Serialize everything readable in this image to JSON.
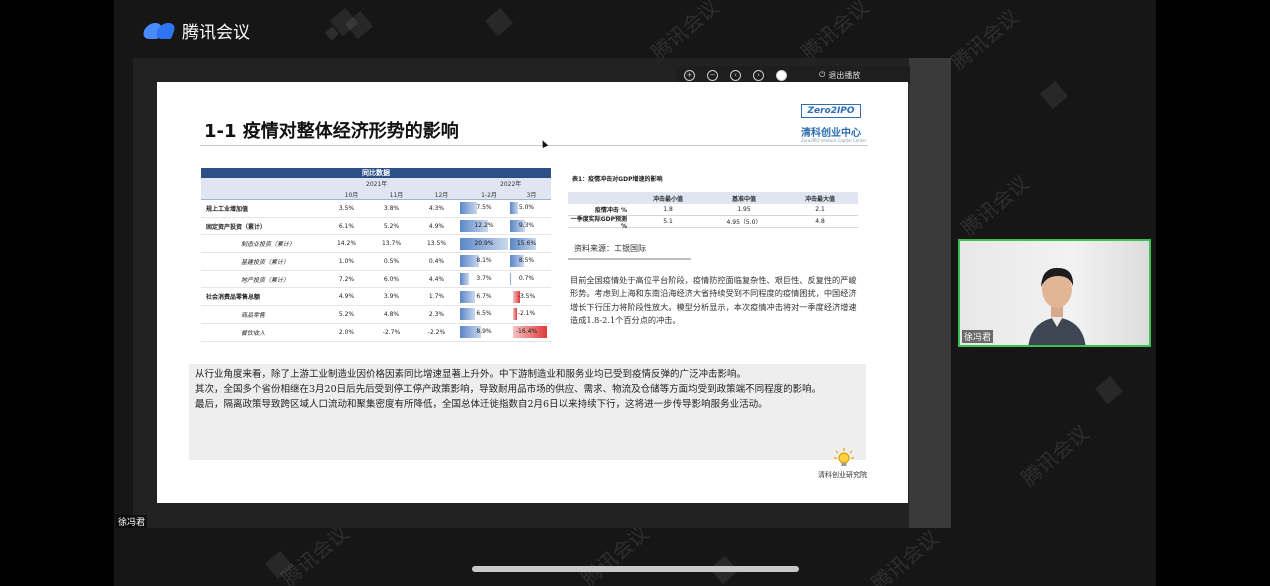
{
  "app": {
    "name": "腾讯会议",
    "watermark": "腾讯会议"
  },
  "toolbar": {
    "exit_label": "退出播放"
  },
  "slide": {
    "title": "1-1 疫情对整体经济形势的影响",
    "logo_text": "Zero2IPO",
    "logo_cn": "清科创业中心",
    "logo_en": "Zero2IPO Venture Capital Center",
    "table1": {
      "header": "同比数据",
      "group_2021": "2021年",
      "group_2022": "2022年",
      "columns": [
        "10月",
        "11月",
        "12月",
        "1-2月",
        "3月"
      ],
      "rows": [
        {
          "label": "规上工业增加值",
          "v": [
            "3.5%",
            "3.8%",
            "4.3%",
            "7.5%",
            "5.0%"
          ],
          "bar1": 0.36,
          "bar2": 0.24,
          "style": "bold"
        },
        {
          "label": "固定资产投资（累计）",
          "v": [
            "6.1%",
            "5.2%",
            "4.9%",
            "12.2%",
            "9.3%"
          ],
          "bar1": 0.58,
          "bar2": 0.44,
          "style": "bold"
        },
        {
          "label": "制造业投资（累计）",
          "v": [
            "14.2%",
            "13.7%",
            "13.5%",
            "20.9%",
            "15.6%"
          ],
          "bar1": 1.0,
          "bar2": 0.75,
          "style": "ital"
        },
        {
          "label": "基建投资（累计）",
          "v": [
            "1.0%",
            "0.5%",
            "0.4%",
            "8.1%",
            "8.5%"
          ],
          "bar1": 0.39,
          "bar2": 0.41,
          "style": "ital"
        },
        {
          "label": "地产投资（累计）",
          "v": [
            "7.2%",
            "6.0%",
            "4.4%",
            "3.7%",
            "0.7%"
          ],
          "bar1": 0.18,
          "bar2": 0.03,
          "style": "ital"
        },
        {
          "label": "社会消费品零售总额",
          "v": [
            "4.9%",
            "3.9%",
            "1.7%",
            "6.7%",
            "-3.5%"
          ],
          "bar1": 0.32,
          "bar2": -0.2,
          "style": "bold"
        },
        {
          "label": "商品零售",
          "v": [
            "5.2%",
            "4.8%",
            "2.3%",
            "6.5%",
            "-2.1%"
          ],
          "bar1": 0.31,
          "bar2": -0.13,
          "style": "ital"
        },
        {
          "label": "餐饮收入",
          "v": [
            "2.0%",
            "-2.7%",
            "-2.2%",
            "8.9%",
            "-16.4%"
          ],
          "bar1": 0.43,
          "bar2": -1.0,
          "style": "ital"
        }
      ]
    },
    "table2": {
      "title": "表1：疫情冲击对GDP增速的影响",
      "columns": [
        "冲击最小值",
        "基准中值",
        "冲击最大值"
      ],
      "rows": [
        {
          "label": "疫情冲击 %",
          "v": [
            "1.8",
            "1.95",
            "2.1"
          ]
        },
        {
          "label": "一季度实际GDP预测 %",
          "v": [
            "5.1",
            "4.95（5.0）",
            "4.8"
          ]
        }
      ]
    },
    "source": "资料来源：工银国际",
    "paragraph": "目前全国疫情处于高位平台阶段，疫情防控面临复杂性、艰巨性、反复性的严峻形势。考虑到上海和东南沿海经济大省持续受到不同程度的疫情困扰，中国经济增长下行压力将阶段性放大。模型分析显示，本次疫情冲击将对一季度经济增速造成1.8-2.1个百分点的冲击。",
    "bottom_text": [
      "从行业角度来看，除了上游工业制造业因价格因素同比增速显著上升外。中下游制造业和服务业均已受到疫情反弹的广泛冲击影响。",
      "其次，全国多个省份相继在3月20日后先后受到停工停产政策影响，导致耐用品市场的供应、需求、物流及仓储等方面均受到政策端不同程度的影响。",
      "最后，隔离政策导致跨区域人口流动和聚集密度有所降低，全国总体迁徙指数自2月6日以来持续下行，这将进一步传导影响服务业活动。"
    ],
    "institute": "清科创业研究院"
  },
  "participants": {
    "video_name": "徐冯君",
    "speaker_name": "徐冯君"
  },
  "colors": {
    "bar_positive": "#5b86c9",
    "bar_negative": "#e03a3a",
    "accent_green": "#3cc24f",
    "header_blue": "#2d4f87"
  }
}
